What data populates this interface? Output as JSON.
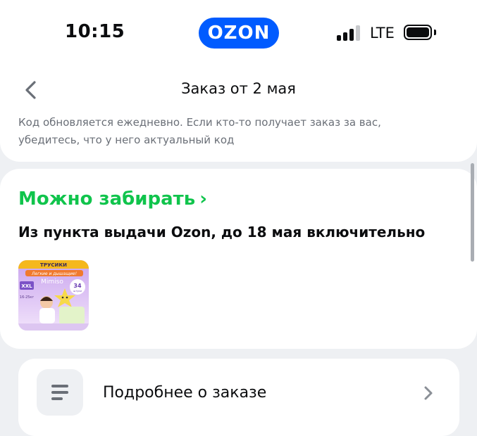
{
  "status_bar": {
    "time": "10:15",
    "brand": "OZON",
    "network": "LTE",
    "icons": [
      "signal-icon",
      "battery-icon"
    ]
  },
  "header": {
    "title": "Заказ от 2 мая",
    "back_icon": "chevron-left-icon",
    "hint": "Код обновляется ежедневно. Если кто-то получает заказ за вас, убедитесь, что у него актуальный код"
  },
  "order_status": {
    "status": "Можно забирать",
    "status_chevron": "›",
    "pickup_info": "Из пункта выдачи Ozon, до 18 мая включительно",
    "item": {
      "image_icon": "product-thumbnail",
      "package_texts": [
        "ТРУСИКИ",
        "Легкие и дышащие!",
        "Mimiso",
        "XXL",
        "16-25кг",
        "34",
        "штуки"
      ]
    }
  },
  "details": {
    "label": "Подробнее о заказе",
    "icon": "list-icon",
    "chevron_icon": "chevron-right-icon"
  },
  "colors": {
    "brand_blue": "#005bff",
    "success_green": "#10c44c",
    "background": "#eef0f3"
  }
}
